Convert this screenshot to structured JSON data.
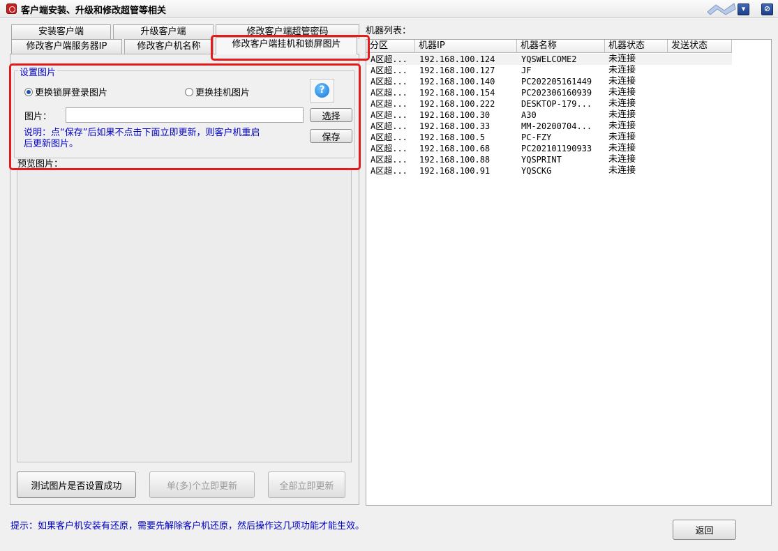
{
  "window": {
    "title": "客户端安装、升级和修改超管等相关",
    "minimize_glyph": "▾",
    "close_glyph": "⊘"
  },
  "tabs": {
    "row1": [
      "安装客户端",
      "升级客户端",
      "修改客户端超管密码"
    ],
    "row2": [
      "修改客户端服务器IP",
      "修改客户机名称",
      "修改客户端挂机和锁屏图片"
    ],
    "active": "修改客户端挂机和锁屏图片"
  },
  "settings": {
    "group_title": "设置图片",
    "radio_lock": "更换锁屏登录图片",
    "radio_hang": "更换挂机图片",
    "selected_radio": "更换锁屏登录图片",
    "help_glyph": "?",
    "image_label": "图片：",
    "image_value": "",
    "select_button": "选择",
    "save_button": "保存",
    "note_line1": "说明：点“保存”后如果不点击下面立即更新，则客户机重启",
    "note_line2": "后更新图片。",
    "preview_label": "预览图片："
  },
  "actions": {
    "test_button": "测试图片是否设置成功",
    "update_selected_button": "单(多)个立即更新",
    "update_all_button": "全部立即更新"
  },
  "machine_list": {
    "label": "机器列表：",
    "columns": [
      "分区",
      "机器IP",
      "机器名称",
      "机器状态",
      "发送状态"
    ],
    "rows": [
      {
        "zone": "A区超...",
        "ip": "192.168.100.124",
        "name": "YQSWELCOME2",
        "status": "未连接",
        "send": ""
      },
      {
        "zone": "A区超...",
        "ip": "192.168.100.127",
        "name": "JF",
        "status": "未连接",
        "send": ""
      },
      {
        "zone": "A区超...",
        "ip": "192.168.100.140",
        "name": "PC202205161449",
        "status": "未连接",
        "send": ""
      },
      {
        "zone": "A区超...",
        "ip": "192.168.100.154",
        "name": "PC202306160939",
        "status": "未连接",
        "send": ""
      },
      {
        "zone": "A区超...",
        "ip": "192.168.100.222",
        "name": "DESKTOP-179...",
        "status": "未连接",
        "send": ""
      },
      {
        "zone": "A区超...",
        "ip": "192.168.100.30",
        "name": "A30",
        "status": "未连接",
        "send": ""
      },
      {
        "zone": "A区超...",
        "ip": "192.168.100.33",
        "name": "MM-20200704...",
        "status": "未连接",
        "send": ""
      },
      {
        "zone": "A区超...",
        "ip": "192.168.100.5",
        "name": "PC-FZY",
        "status": "未连接",
        "send": ""
      },
      {
        "zone": "A区超...",
        "ip": "192.168.100.68",
        "name": "PC202101190933",
        "status": "未连接",
        "send": ""
      },
      {
        "zone": "A区超...",
        "ip": "192.168.100.88",
        "name": "YQSPRINT",
        "status": "未连接",
        "send": ""
      },
      {
        "zone": "A区超...",
        "ip": "192.168.100.91",
        "name": "YQSCKG",
        "status": "未连接",
        "send": ""
      }
    ]
  },
  "footer": {
    "hint": "提示：如果客户机安装有还原，需要先解除客户机还原，然后操作这几项功能才能生效。",
    "back_button": "返回"
  },
  "colors": {
    "highlight_red": "#e51a1a",
    "info_blue": "#0000c8"
  }
}
